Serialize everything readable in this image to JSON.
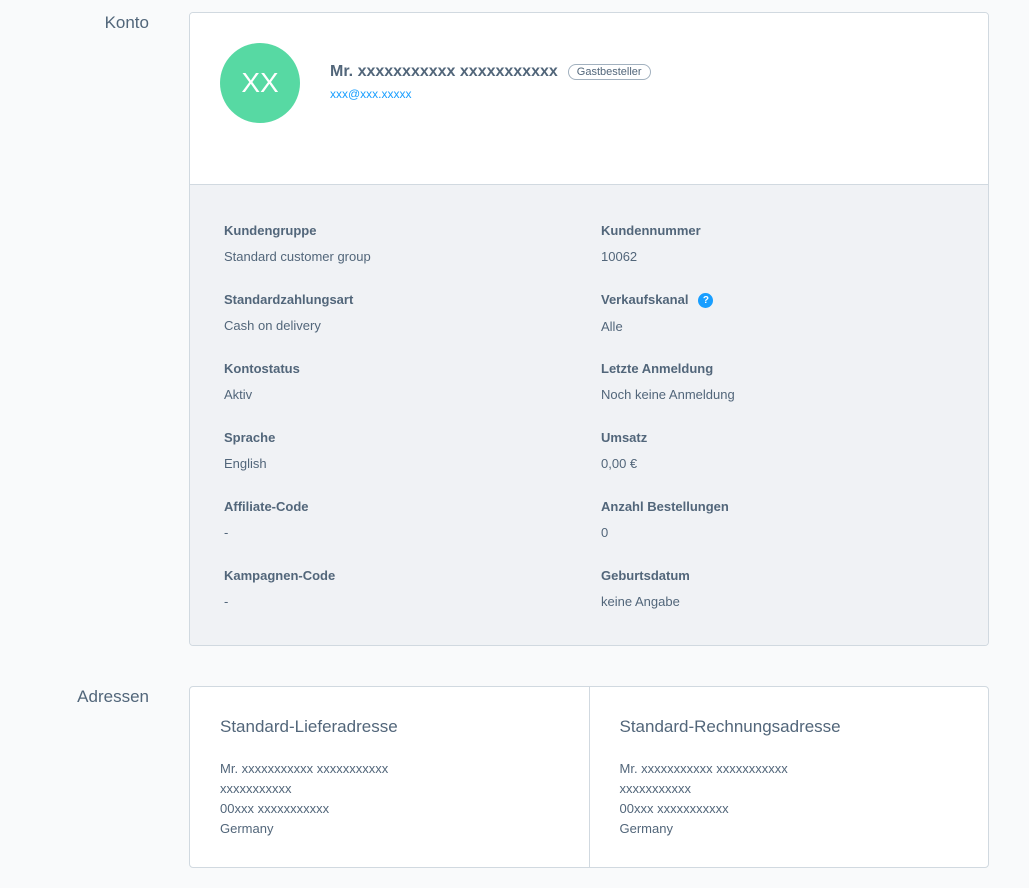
{
  "sections": {
    "konto": "Konto",
    "adressen": "Adressen"
  },
  "customer": {
    "initials": "XX",
    "name": "Mr. xxxxxxxxxxx xxxxxxxxxxx",
    "badge": "Gastbesteller",
    "email": "xxx@xxx.xxxxx"
  },
  "fields_left": [
    {
      "label": "Kundengruppe",
      "value": "Standard customer group"
    },
    {
      "label": "Standardzahlungsart",
      "value": "Cash on delivery"
    },
    {
      "label": "Kontostatus",
      "value": "Aktiv"
    },
    {
      "label": "Sprache",
      "value": "English"
    },
    {
      "label": "Affiliate-Code",
      "value": "-"
    },
    {
      "label": "Kampagnen-Code",
      "value": "-"
    }
  ],
  "fields_right": [
    {
      "label": "Kundennummer",
      "value": "10062"
    },
    {
      "label": "Verkaufskanal",
      "value": "Alle"
    },
    {
      "label": "Letzte Anmeldung",
      "value": "Noch keine Anmeldung"
    },
    {
      "label": "Umsatz",
      "value": "0,00 €"
    },
    {
      "label": "Anzahl Bestellungen",
      "value": "0"
    },
    {
      "label": "Geburtsdatum",
      "value": "keine Angabe"
    }
  ],
  "help_icon_glyph": "?",
  "addresses": [
    {
      "title": "Standard-Lieferadresse",
      "lines": [
        "Mr. xxxxxxxxxxx xxxxxxxxxxx",
        "xxxxxxxxxxx",
        "00xxx xxxxxxxxxxx",
        "Germany"
      ]
    },
    {
      "title": "Standard-Rechnungsadresse",
      "lines": [
        "Mr. xxxxxxxxxxx xxxxxxxxxxx",
        "xxxxxxxxxxx",
        "00xxx xxxxxxxxxxx",
        "Germany"
      ]
    }
  ],
  "colors": {
    "avatar": "#57d9a3",
    "link": "#189eff",
    "panel": "#f0f2f5"
  }
}
